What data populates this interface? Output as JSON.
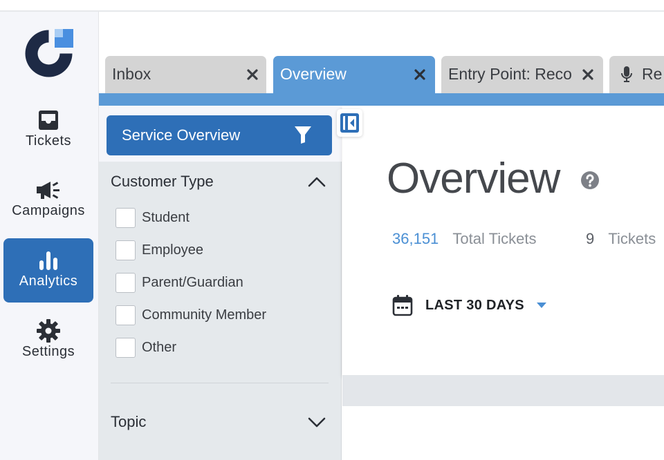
{
  "nav": {
    "items": [
      {
        "label": "Tickets",
        "icon": "inbox-tray-icon"
      },
      {
        "label": "Campaigns",
        "icon": "megaphone-icon"
      },
      {
        "label": "Analytics",
        "icon": "bar-chart-icon",
        "active": true
      },
      {
        "label": "Settings",
        "icon": "gear-icon"
      }
    ]
  },
  "tabs": [
    {
      "label": "Inbox"
    },
    {
      "label": "Overview",
      "active": true
    },
    {
      "label": "Entry Point: Reco"
    },
    {
      "label": "Re",
      "icon": "microphone-icon"
    }
  ],
  "filter": {
    "service_button": "Service Overview",
    "sections": [
      {
        "title": "Customer Type",
        "expanded": true,
        "options": [
          "Student",
          "Employee",
          "Parent/Guardian",
          "Community Member",
          "Other"
        ]
      },
      {
        "title": "Topic",
        "expanded": false
      }
    ]
  },
  "overview": {
    "title": "Overview",
    "stats": [
      {
        "value": "36,151",
        "label": "Total Tickets"
      },
      {
        "value": "9",
        "label": "Tickets"
      }
    ],
    "date_range": "LAST 30 DAYS"
  },
  "colors": {
    "primary": "#2e6fb7",
    "tab_active": "#5b9ad6",
    "logo_dark": "#1e2a45",
    "logo_accent": "#4a8fe0"
  }
}
